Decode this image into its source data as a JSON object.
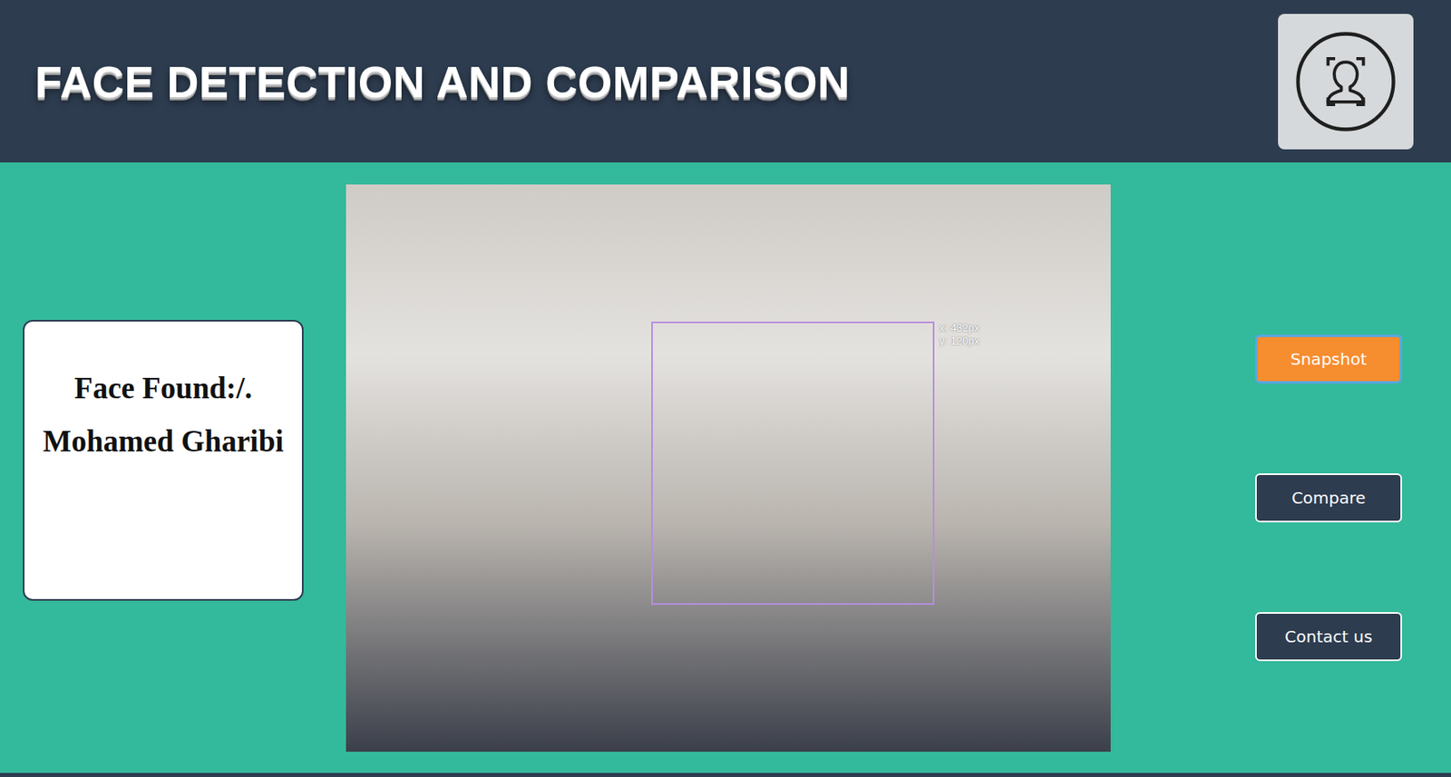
{
  "header": {
    "title": "FACE DETECTION AND COMPARISON"
  },
  "result": {
    "lines": [
      "Face Found:/.",
      "Mohamed Gharibi"
    ]
  },
  "camera": {
    "detection": {
      "labels": [
        "x: 432px",
        "y: 120px"
      ]
    }
  },
  "buttons": [
    {
      "label": "Snapshot",
      "selected": true
    },
    {
      "label": "Compare",
      "selected": false
    },
    {
      "label": "Contact us",
      "selected": false
    }
  ]
}
